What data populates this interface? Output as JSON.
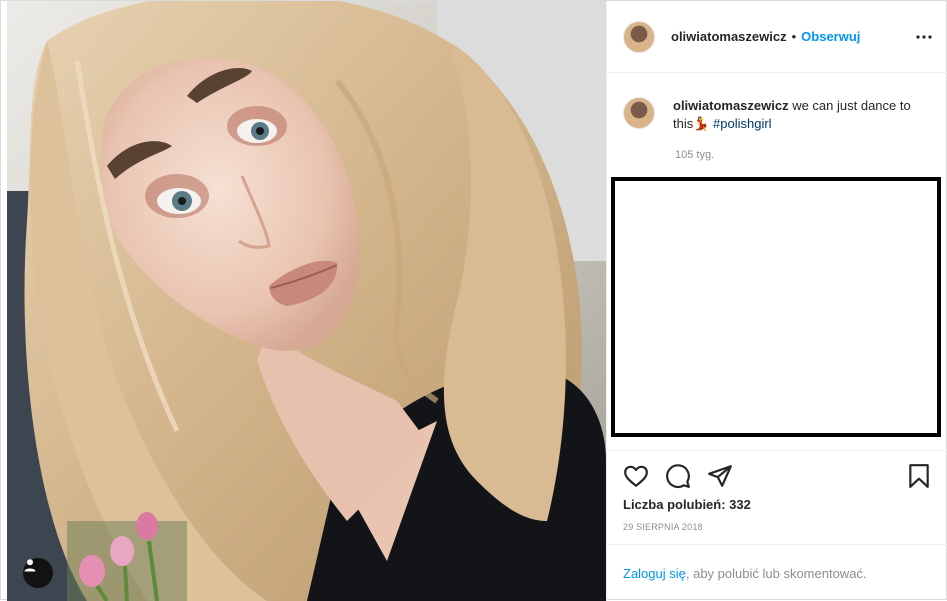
{
  "post": {
    "author": {
      "username": "oliwiatomaszewicz",
      "separator": "•",
      "follow_label": "Obserwuj"
    },
    "caption": {
      "username": "oliwiatomaszewicz",
      "text": " we can just dance to this💃 ",
      "hashtag": "#polishgirl",
      "time": "105 tyg."
    },
    "actions": {
      "like_icon": "heart-icon",
      "comment_icon": "comment-icon",
      "share_icon": "paper-plane-icon",
      "save_icon": "bookmark-icon"
    },
    "likes": {
      "label": "Liczba polubień: ",
      "count": "332"
    },
    "date": "29 SIERPNIA 2018",
    "login_prompt": {
      "link": "Zaloguj się",
      "text": ", aby polubić lub skomentować."
    },
    "colors": {
      "link_blue": "#0095f6",
      "hashtag": "#00376b",
      "muted": "#8e8e8e",
      "border": "#dbdbdb"
    }
  }
}
